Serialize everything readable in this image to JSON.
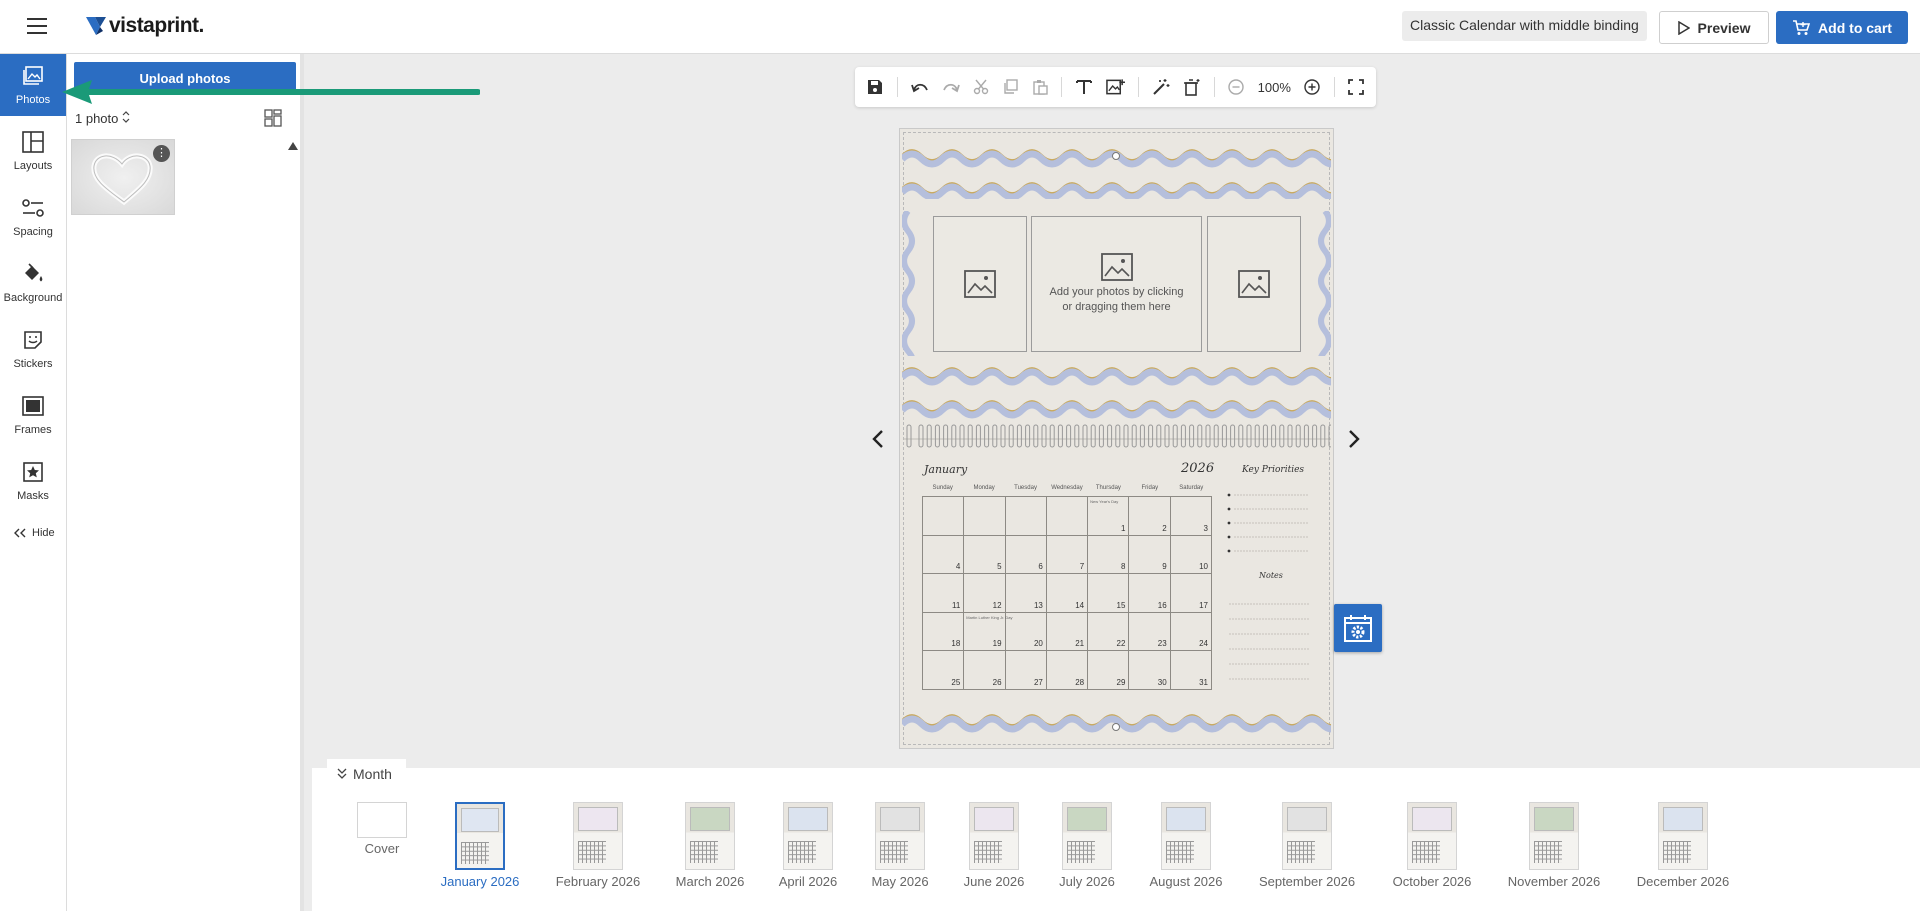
{
  "header": {
    "logo_text": "vistaprint.",
    "product_name": "Classic Calendar with middle binding",
    "preview_label": "Preview",
    "cart_label": "Add to cart"
  },
  "rail": {
    "items": [
      {
        "label": "Photos",
        "icon": "photo-icon",
        "active": true
      },
      {
        "label": "Layouts",
        "icon": "layout-icon"
      },
      {
        "label": "Spacing",
        "icon": "spacing-icon"
      },
      {
        "label": "Background",
        "icon": "paint-bucket-icon"
      },
      {
        "label": "Stickers",
        "icon": "sticker-icon"
      },
      {
        "label": "Frames",
        "icon": "frame-icon"
      },
      {
        "label": "Masks",
        "icon": "mask-icon"
      }
    ],
    "hide_label": "Hide"
  },
  "panel": {
    "upload_label": "Upload photos",
    "photo_count": "1 photo"
  },
  "toolbar": {
    "zoom": "100%"
  },
  "canvas": {
    "slot_text": "Add your photos by clicking or dragging them here",
    "month": "January",
    "year": "2026",
    "priorities_title": "Key Priorities",
    "notes_title": "Notes",
    "weekdays": [
      "Sunday",
      "Monday",
      "Tuesday",
      "Wednesday",
      "Thursday",
      "Friday",
      "Saturday"
    ],
    "days": [
      "",
      "",
      "",
      "",
      "1",
      "2",
      "3",
      "4",
      "5",
      "6",
      "7",
      "8",
      "9",
      "10",
      "11",
      "12",
      "13",
      "14",
      "15",
      "16",
      "17",
      "18",
      "19",
      "20",
      "21",
      "22",
      "23",
      "24",
      "25",
      "26",
      "27",
      "28",
      "29",
      "30",
      "31"
    ],
    "holiday_new_year": "New Year's Day",
    "holiday_mlk": "Martin Luther King Jr. Day"
  },
  "month_strip": {
    "tab_label": "Month",
    "pages": [
      "Cover",
      "January 2026",
      "February 2026",
      "March 2026",
      "April 2026",
      "May 2026",
      "June 2026",
      "July 2026",
      "August 2026",
      "September 2026",
      "October 2026",
      "November 2026",
      "December 2026"
    ],
    "selected": "January 2026"
  },
  "colors": {
    "accent": "#2b6dc2",
    "annotation_arrow": "#1a9a78",
    "wave_blue": "#b5bfdc",
    "wave_gold": "#c9a95e"
  }
}
